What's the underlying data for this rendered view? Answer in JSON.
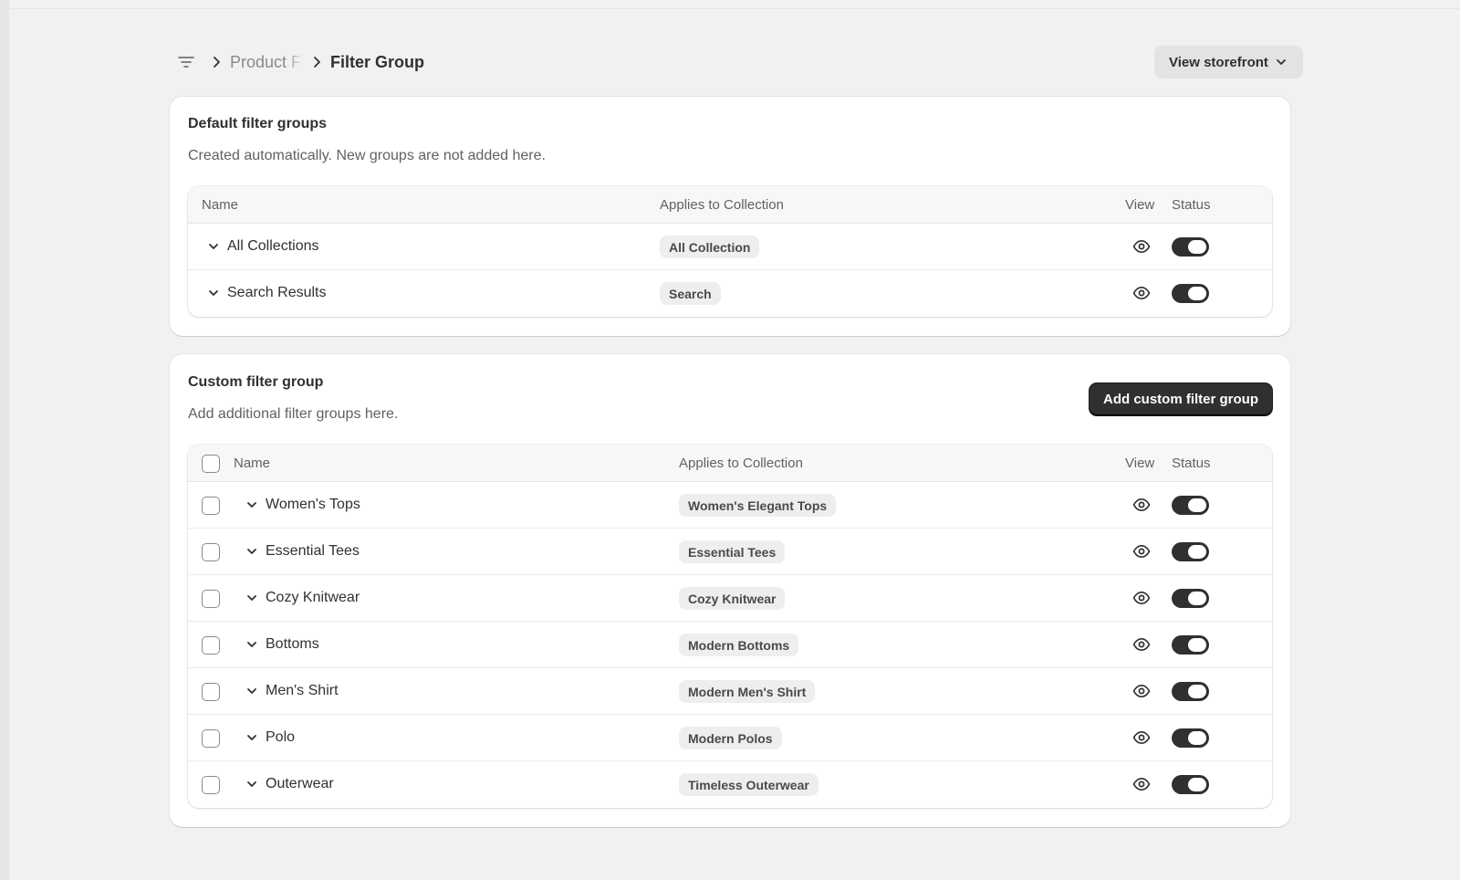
{
  "breadcrumb": {
    "icon": "filter-lines-icon",
    "parent": "Product Filter",
    "current": "Filter Group"
  },
  "header": {
    "storefront_label": "View storefront"
  },
  "default_section": {
    "title": "Default filter groups",
    "description": "Created automatically. New groups are not added here.",
    "columns": {
      "name": "Name",
      "applies": "Applies to Collection",
      "view": "View",
      "status": "Status"
    },
    "rows": [
      {
        "name": "All Collections",
        "collection": "All Collection",
        "status_on": true
      },
      {
        "name": "Search Results",
        "collection": "Search",
        "status_on": true
      }
    ]
  },
  "custom_section": {
    "title": "Custom filter group",
    "description": "Add additional filter groups here.",
    "add_label": "Add custom filter group",
    "columns": {
      "name": "Name",
      "applies": "Applies to Collection",
      "view": "View",
      "status": "Status"
    },
    "rows": [
      {
        "name": "Women's Tops",
        "collection": "Women's Elegant Tops",
        "status_on": true,
        "checked": false
      },
      {
        "name": "Essential Tees",
        "collection": "Essential Tees",
        "status_on": true,
        "checked": false
      },
      {
        "name": "Cozy Knitwear",
        "collection": "Cozy Knitwear",
        "status_on": true,
        "checked": false
      },
      {
        "name": "Bottoms",
        "collection": "Modern Bottoms",
        "status_on": true,
        "checked": false
      },
      {
        "name": "Men's Shirt",
        "collection": "Modern Men's Shirt",
        "status_on": true,
        "checked": false
      },
      {
        "name": "Polo",
        "collection": "Modern Polos",
        "status_on": true,
        "checked": false
      },
      {
        "name": "Outerwear",
        "collection": "Timeless Outerwear",
        "status_on": true,
        "checked": false
      }
    ]
  },
  "colors": {
    "primary_button": "#303030",
    "toggle_on": "#303030",
    "background": "#f1f1f1"
  }
}
